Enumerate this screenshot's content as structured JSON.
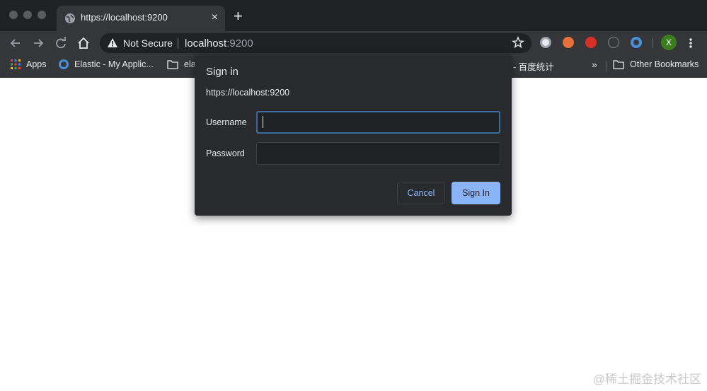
{
  "tab": {
    "title": "https://localhost:9200",
    "close": "×"
  },
  "new_tab": "+",
  "omnibox": {
    "security_text": "Not Secure",
    "url_host": "localhost",
    "url_port": ":9200"
  },
  "profile": {
    "initial": "X",
    "color": "#3a7d1e"
  },
  "bookmarks": {
    "apps": "Apps",
    "elastic": "Elastic - My Applic...",
    "folder_partial": "ela",
    "baidu_partial": "I - 百度统计",
    "more": "»",
    "other": "Other Bookmarks"
  },
  "dialog": {
    "title": "Sign in",
    "origin": "https://localhost:9200",
    "username_label": "Username",
    "username_value": "",
    "password_label": "Password",
    "password_value": "",
    "cancel_label": "Cancel",
    "signin_label": "Sign In"
  },
  "colors": {
    "accent": "#8ab4f8",
    "chrome_dark": "#35363a",
    "frame": "#202124"
  },
  "watermark": "@稀土掘金技术社区"
}
